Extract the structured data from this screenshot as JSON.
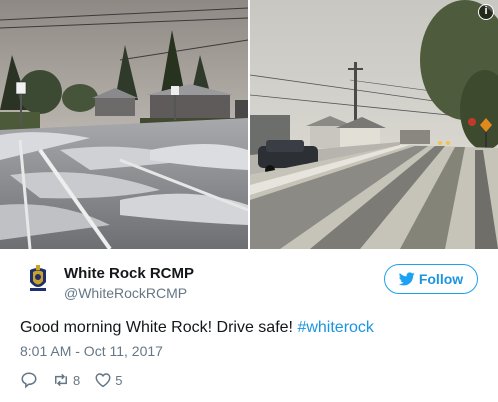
{
  "tweet": {
    "display_name": "White Rock RCMP",
    "handle": "@WhiteRockRCMP",
    "follow_label": "Follow",
    "text_main": "Good morning White Rock! Drive safe! ",
    "hashtag": "#whiterock",
    "timestamp": "8:01 AM - Oct 11, 2017",
    "retweet_count": "8",
    "like_count": "5",
    "info_label": "i"
  },
  "icons": {
    "info": "info-icon",
    "follow": "twitter-bird-icon",
    "reply": "reply-icon",
    "retweet": "retweet-icon",
    "like": "heart-icon",
    "avatar": "rcmp-badge-logo"
  },
  "colors": {
    "accent": "#1da1f2",
    "link": "#1b95e0",
    "secondary_text": "#657786",
    "primary_text": "#14171a"
  }
}
